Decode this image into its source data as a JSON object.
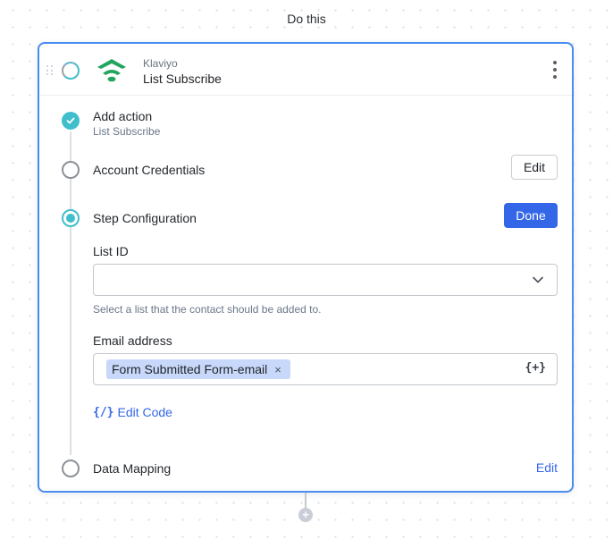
{
  "canvas": {
    "step_title": "Do this"
  },
  "card": {
    "app_name": "Klaviyo",
    "action_name": "List Subscribe",
    "icons": {
      "drag": "drag-handle-icon",
      "status": "status-ring-icon",
      "logo": "klaviyo-logo-icon",
      "menu": "more-vertical-icon"
    },
    "colors": {
      "card_border": "#4a8df0",
      "logo_green": "#23a55e",
      "status_teal": "#3fbfcb",
      "primary_blue": "#3467e8",
      "token_bg": "#c8d8fa"
    }
  },
  "sections": [
    {
      "label": "Add action",
      "sublabel": "List Subscribe",
      "state": "complete"
    },
    {
      "label": "Account Credentials",
      "state": "incomplete",
      "action": "Edit"
    },
    {
      "label": "Step Configuration",
      "state": "active",
      "action": "Done"
    },
    {
      "label": "Data Mapping",
      "state": "incomplete",
      "action": "Edit"
    }
  ],
  "config": {
    "list_id": {
      "label": "List ID",
      "value": "",
      "help": "Select a list that the contact should be added to."
    },
    "email": {
      "label": "Email address",
      "token": "Form Submitted Form-email",
      "token_remove": "×",
      "insert_variable": "{+}"
    },
    "edit_code": {
      "icon": "{/}",
      "label": "Edit Code"
    }
  },
  "footer": {
    "add_step": "+"
  }
}
